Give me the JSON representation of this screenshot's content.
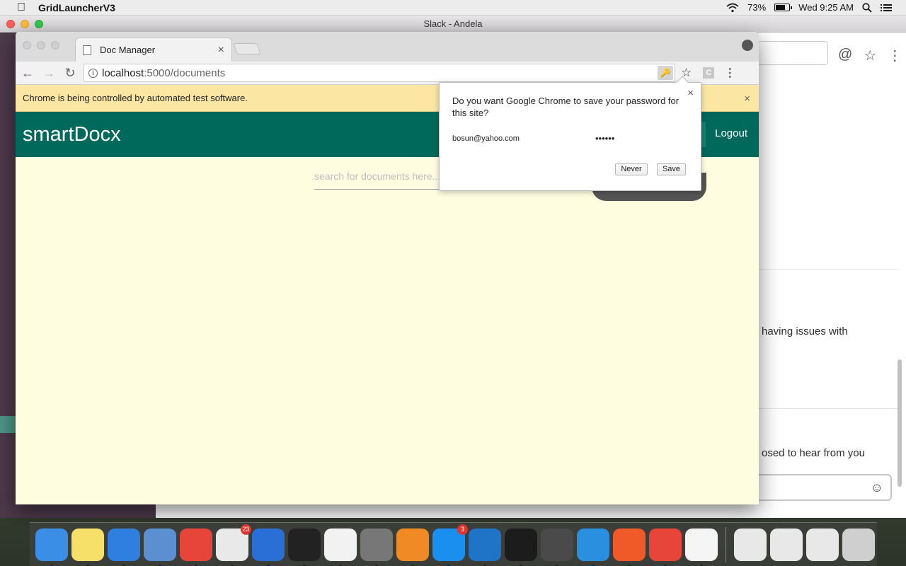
{
  "menubar": {
    "app_name": "GridLauncherV3",
    "battery_percent": "73%",
    "battery_level": 0.73,
    "clock": "Wed 9:25 AM"
  },
  "slack": {
    "window_title": "Slack - Andela",
    "message_1": "having issues with",
    "message_2": "osed to hear from you"
  },
  "chrome": {
    "tab_title": "Doc Manager",
    "url_host": "localhost",
    "url_path": ":5000/documents",
    "extension_label": "C",
    "infobar_text": "Chrome is being controlled by automated test software."
  },
  "app": {
    "brand": "smartDocx",
    "logout_label": "Logout",
    "search_placeholder": "search for documents here..."
  },
  "password_bubble": {
    "question": "Do you want Google Chrome to save your password for this site?",
    "username": "bosun@yahoo.com",
    "password_masked": "••••••",
    "never_label": "Never",
    "save_label": "Save"
  },
  "dock": {
    "items": [
      {
        "name": "finder",
        "color": "#3a8ee6"
      },
      {
        "name": "notes",
        "color": "#f6e06a"
      },
      {
        "name": "safari",
        "color": "#2f7fe0"
      },
      {
        "name": "preview",
        "color": "#5b8fd1"
      },
      {
        "name": "chrome",
        "color": "#e7453a"
      },
      {
        "name": "slack",
        "color": "#e9e9e9",
        "badge": "23"
      },
      {
        "name": "keynote",
        "color": "#2a6fd6"
      },
      {
        "name": "terminal",
        "color": "#222222"
      },
      {
        "name": "itunes",
        "color": "#f2f2f2"
      },
      {
        "name": "system-preferences",
        "color": "#777777"
      },
      {
        "name": "ibooks",
        "color": "#f08a24"
      },
      {
        "name": "app-store",
        "color": "#1a8ff0",
        "badge": "3"
      },
      {
        "name": "vscode",
        "color": "#1f74c8"
      },
      {
        "name": "terminal-2",
        "color": "#1c1c1c"
      },
      {
        "name": "sublime-text",
        "color": "#4a4a4a"
      },
      {
        "name": "sequel-pro",
        "color": "#2b8fe0"
      },
      {
        "name": "postman",
        "color": "#f05a28"
      },
      {
        "name": "chrome-2",
        "color": "#e7453a"
      },
      {
        "name": "java",
        "color": "#f5f5f5"
      },
      {
        "name": "window-1",
        "color": "#e8e8e8"
      },
      {
        "name": "window-2",
        "color": "#e8e8e8"
      },
      {
        "name": "window-3",
        "color": "#e8e8e8"
      },
      {
        "name": "trash",
        "color": "#cfcfcf"
      }
    ]
  }
}
